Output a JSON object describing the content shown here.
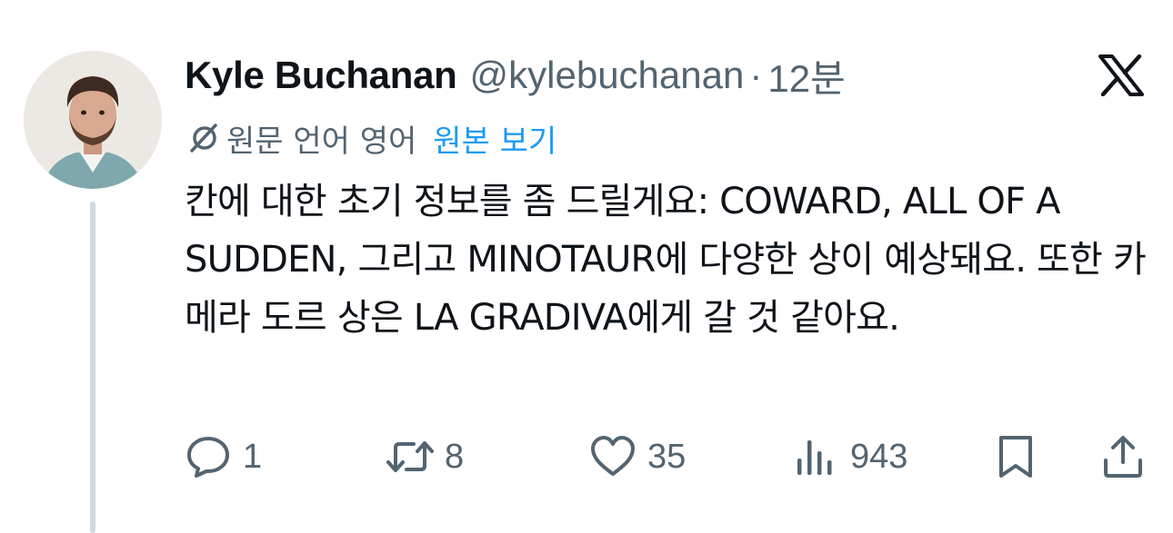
{
  "author": {
    "name": "Kyle Buchanan",
    "handle": "@kylebuchanan",
    "separator": "·",
    "time": "12분"
  },
  "translation": {
    "label": "원문 언어 영어",
    "view_original": "원본 보기"
  },
  "tweet": {
    "text": "칸에 대한 초기 정보를 좀 드릴게요: COWARD, ALL OF A SUDDEN, 그리고 MINOTAUR에 다양한 상이 예상돼요. 또한 카메라 도르 상은 LA GRADIVA에게 갈 것 같아요."
  },
  "actions": {
    "replies": "1",
    "reposts": "8",
    "likes": "35",
    "views": "943"
  },
  "icons": {
    "logo": "x-logo-icon",
    "translate": "translate-icon",
    "reply": "reply-icon",
    "repost": "repost-icon",
    "like": "heart-icon",
    "views": "views-icon",
    "bookmark": "bookmark-icon",
    "share": "share-icon"
  },
  "colors": {
    "text": "#0f1419",
    "secondary": "#536471",
    "link": "#1d9bf0",
    "thread_line": "#cfd9de"
  }
}
